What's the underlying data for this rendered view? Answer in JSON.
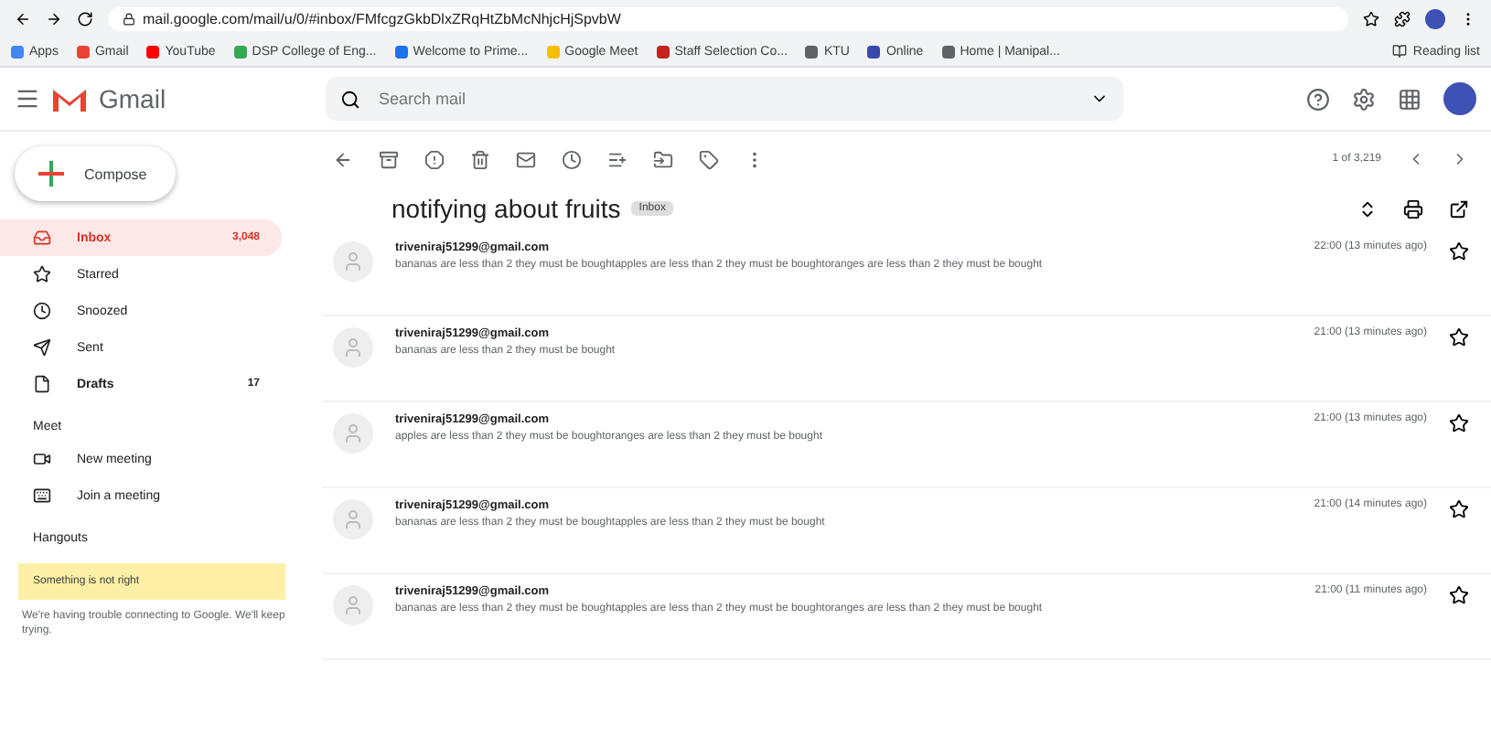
{
  "browser": {
    "url": "mail.google.com/mail/u/0/#inbox/FMfcgzGkbDlxZRqHtZbMcNhjcHjSpvbW",
    "bookmarks": [
      {
        "label": "Apps",
        "color": "#4285f4"
      },
      {
        "label": "Gmail",
        "color": "#ea4335"
      },
      {
        "label": "YouTube",
        "color": "#ff0000"
      },
      {
        "label": "DSP College of Eng...",
        "color": "#34a853"
      },
      {
        "label": "Welcome to Prime...",
        "color": "#1a73e8"
      },
      {
        "label": "Google Meet",
        "color": "#fbbc04"
      },
      {
        "label": "Staff Selection Co...",
        "color": "#c5221f"
      },
      {
        "label": "KTU",
        "color": "#5f6368"
      },
      {
        "label": "Online",
        "color": "#3949ab"
      },
      {
        "label": "Home | Manipal...",
        "color": "#5f6368"
      }
    ],
    "reading_list": "Reading list"
  },
  "header": {
    "logo": "Gmail",
    "search": {
      "placeholder": "Search mail"
    }
  },
  "sidebar": {
    "compose": "Compose",
    "items": [
      {
        "label": "Inbox",
        "count": "3,048",
        "selected": true,
        "bold": true
      },
      {
        "label": "Starred",
        "selected": false,
        "bold": false
      },
      {
        "label": "Snoozed",
        "selected": false,
        "bold": false
      },
      {
        "label": "Sent",
        "selected": false,
        "bold": false
      },
      {
        "label": "Drafts",
        "count": "17",
        "selected": false,
        "bold": true
      }
    ],
    "meet": {
      "title": "Meet",
      "items": [
        "New meeting",
        "Join a meeting"
      ]
    },
    "hangouts": {
      "title": "Hangouts",
      "alert": "Something is not right",
      "message": "We're having trouble connecting to Google. We'll keep trying."
    }
  },
  "toolbar": {
    "pagination": "1 of 3,219"
  },
  "thread": {
    "subject": "notifying about fruits",
    "label": "Inbox",
    "messages": [
      {
        "sender": "triveniraj51299@gmail.com",
        "snippet": "bananas are less than 2 they must be boughtapples are less than 2 they must be boughtoranges are less than 2 they must be bought",
        "time": "22:00 (13 minutes ago)"
      },
      {
        "sender": "triveniraj51299@gmail.com",
        "snippet": "bananas are less than 2 they must be bought",
        "time": "21:00 (13 minutes ago)"
      },
      {
        "sender": "triveniraj51299@gmail.com",
        "snippet": "apples are less than 2 they must be boughtoranges are less than 2 they must be bought",
        "time": "21:00 (13 minutes ago)"
      },
      {
        "sender": "triveniraj51299@gmail.com",
        "snippet": "bananas are less than 2 they must be boughtapples are less than 2 they must be bought",
        "time": "21:00 (14 minutes ago)"
      },
      {
        "sender": "triveniraj51299@gmail.com",
        "snippet": "bananas are less than 2 they must be boughtapples are less than 2 they must be boughtoranges are less than 2 they must be bought",
        "time": "21:00 (11 minutes ago)"
      }
    ]
  }
}
